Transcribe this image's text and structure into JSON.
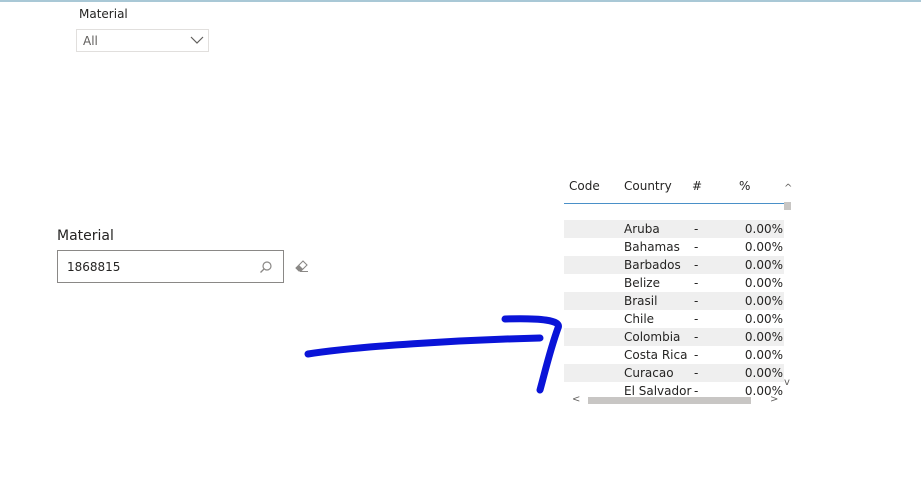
{
  "slicer_dropdown": {
    "title": "Material",
    "value": "All"
  },
  "slicer_search": {
    "title": "Material",
    "value": "1868815"
  },
  "table": {
    "columns": [
      "Code",
      "Country",
      "#",
      "%"
    ],
    "rows": [
      {
        "code": "",
        "country": "Aruba",
        "count": "-",
        "pct": "0.00%"
      },
      {
        "code": "",
        "country": "Bahamas",
        "count": "-",
        "pct": "0.00%"
      },
      {
        "code": "",
        "country": "Barbados",
        "count": "-",
        "pct": "0.00%"
      },
      {
        "code": "",
        "country": "Belize",
        "count": "-",
        "pct": "0.00%"
      },
      {
        "code": "",
        "country": "Brasil",
        "count": "-",
        "pct": "0.00%"
      },
      {
        "code": "",
        "country": "Chile",
        "count": "-",
        "pct": "0.00%"
      },
      {
        "code": "",
        "country": "Colombia",
        "count": "-",
        "pct": "0.00%"
      },
      {
        "code": "",
        "country": "Costa Rica",
        "count": "-",
        "pct": "0.00%"
      },
      {
        "code": "",
        "country": "Curacao",
        "count": "-",
        "pct": "0.00%"
      },
      {
        "code": "",
        "country": "El Salvador",
        "count": "-",
        "pct": "0.00%"
      }
    ]
  },
  "icons": {
    "dropdown": "chevron-down-icon",
    "search": "search-icon",
    "clear": "eraser-icon",
    "scroll_up": "chevron-up-icon",
    "scroll_down": "chevron-down-icon",
    "scroll_left": "chevron-left-icon",
    "scroll_right": "chevron-right-icon"
  },
  "colors": {
    "annotation": "#0a14d8",
    "header_underline": "#4a90c8",
    "row_shade": "#efefef"
  }
}
